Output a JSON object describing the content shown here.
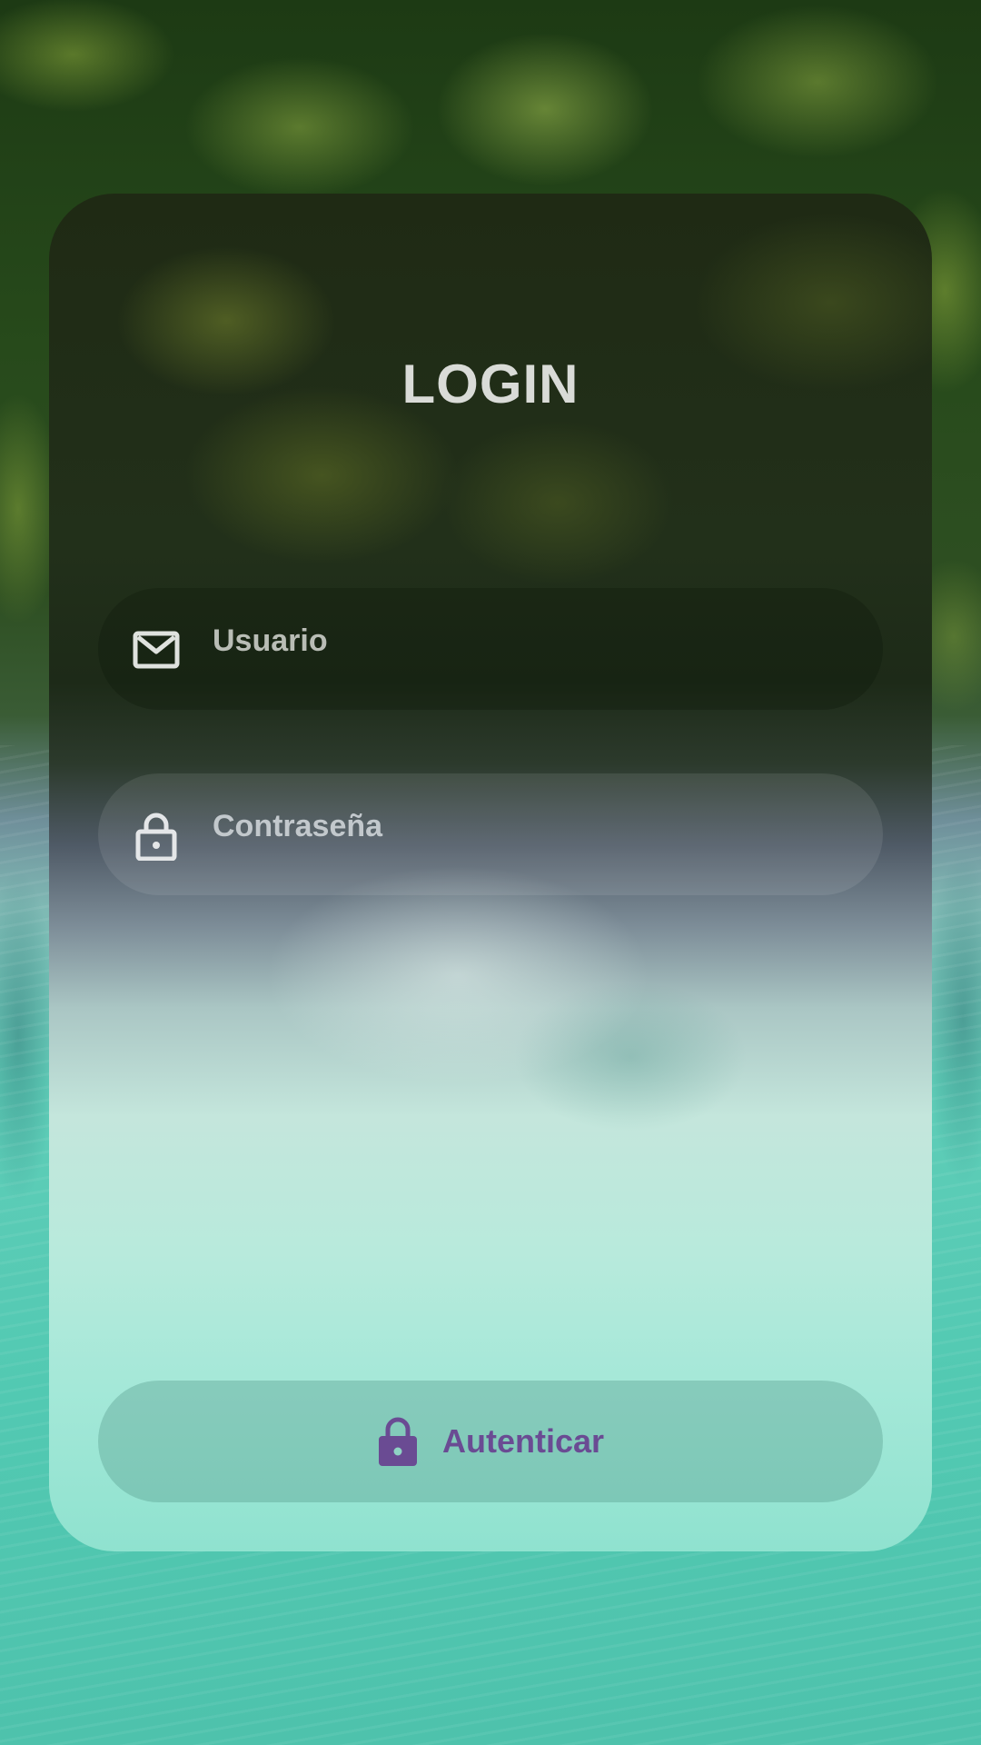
{
  "login": {
    "title": "LOGIN",
    "username": {
      "placeholder": "Usuario",
      "value": "",
      "icon": "mail-icon"
    },
    "password": {
      "placeholder": "Contraseña",
      "value": "",
      "icon": "lock-icon"
    },
    "submit": {
      "label": "Autenticar",
      "icon": "lock-icon"
    }
  },
  "colors": {
    "title": "#d9dbd7",
    "placeholder": "#b9bdb6",
    "button_text": "#6a4b93",
    "button_icon": "#6a4b93"
  }
}
